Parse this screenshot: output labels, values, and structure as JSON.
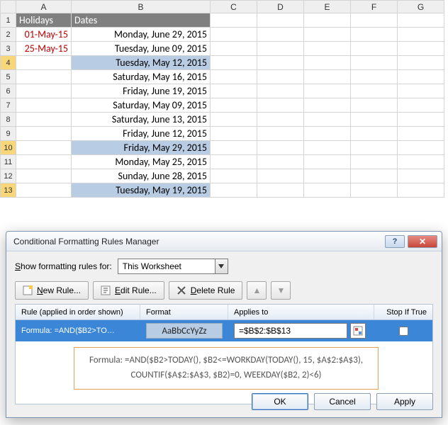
{
  "columns": [
    "A",
    "B",
    "C",
    "D",
    "E",
    "F",
    "G"
  ],
  "rows": [
    1,
    2,
    3,
    4,
    5,
    6,
    7,
    8,
    9,
    10,
    11,
    12,
    13
  ],
  "header": {
    "A": "Holidays",
    "B": "Dates"
  },
  "data": {
    "A2": "01-May-15",
    "A3": "25-May-15",
    "B2": "Monday, June 29, 2015",
    "B3": "Tuesday, June 09, 2015",
    "B4": "Tuesday, May 12, 2015",
    "B5": "Saturday, May 16, 2015",
    "B6": "Friday, June 19, 2015",
    "B7": "Saturday, May 09, 2015",
    "B8": "Saturday, June 13, 2015",
    "B9": "Friday, June 12, 2015",
    "B10": "Friday, May 29, 2015",
    "B11": "Monday, May 25, 2015",
    "B12": "Sunday, June 28, 2015",
    "B13": "Tuesday, May 19, 2015"
  },
  "highlight": [
    "B4",
    "B10",
    "B13"
  ],
  "dialog": {
    "title": "Conditional Formatting Rules Manager",
    "showFor": {
      "label": "Show formatting rules for:",
      "value": "This Worksheet"
    },
    "buttons": {
      "new": "New Rule...",
      "edit": "Edit Rule...",
      "delete": "Delete Rule"
    },
    "grid": {
      "cols": {
        "rule": "Rule (applied in order shown)",
        "format": "Format",
        "applies": "Applies to",
        "stop": "Stop If True"
      },
      "row": {
        "rule": "Formula: =AND($B2>TO…",
        "formatPreview": "AaBbCcYyZz",
        "appliesTo": "=$B$2:$B$13"
      }
    },
    "callout": {
      "line1": "Formula: =AND($B2>TODAY(), $B2<=WORKDAY(TODAY(), 15, $A$2:$A$3),",
      "line2": "COUNTIF($A$2:$A$3, $B2)=0, WEEKDAY($B2, 2)<6)"
    },
    "footer": {
      "ok": "OK",
      "cancel": "Cancel",
      "apply": "Apply"
    }
  }
}
